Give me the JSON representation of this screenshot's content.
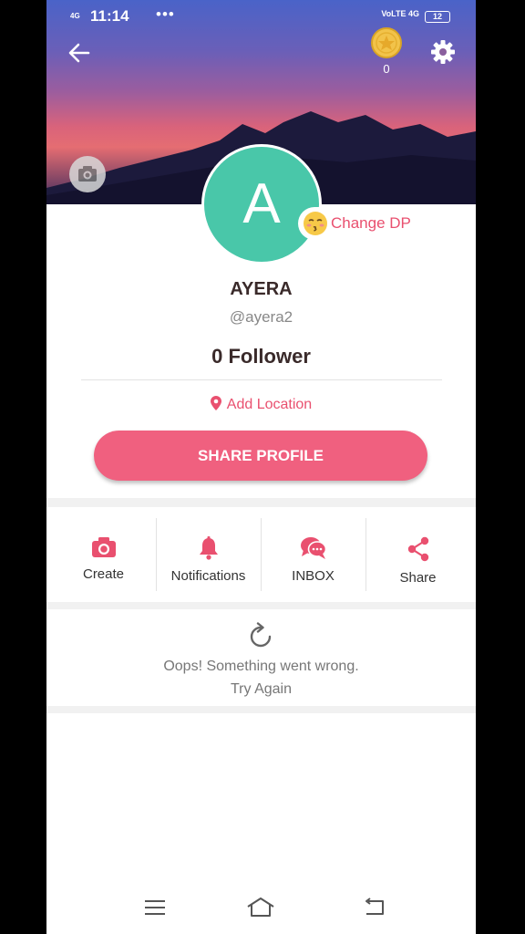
{
  "status_bar": {
    "signal": "4G",
    "time": "11:14",
    "dots": "•••",
    "network": "VoLTE 4G",
    "battery": "12"
  },
  "header": {
    "coin_count": "0"
  },
  "profile": {
    "avatar_letter": "A",
    "change_dp_label": "Change DP",
    "name": "AYERA",
    "handle": "@ayera2",
    "followers": "0 Follower",
    "location_label": "Add Location",
    "share_button": "SHARE PROFILE"
  },
  "actions": [
    {
      "label": "Create",
      "icon": "camera-icon"
    },
    {
      "label": "Notifications",
      "icon": "bell-icon"
    },
    {
      "label": "INBOX",
      "icon": "chat-bubbles-icon"
    },
    {
      "label": "Share",
      "icon": "share-icon"
    }
  ],
  "error": {
    "message": "Oops! Something went wrong.",
    "retry_label": "Try Again"
  },
  "colors": {
    "accent": "#f0607f",
    "avatar_bg": "#49c7a9"
  }
}
